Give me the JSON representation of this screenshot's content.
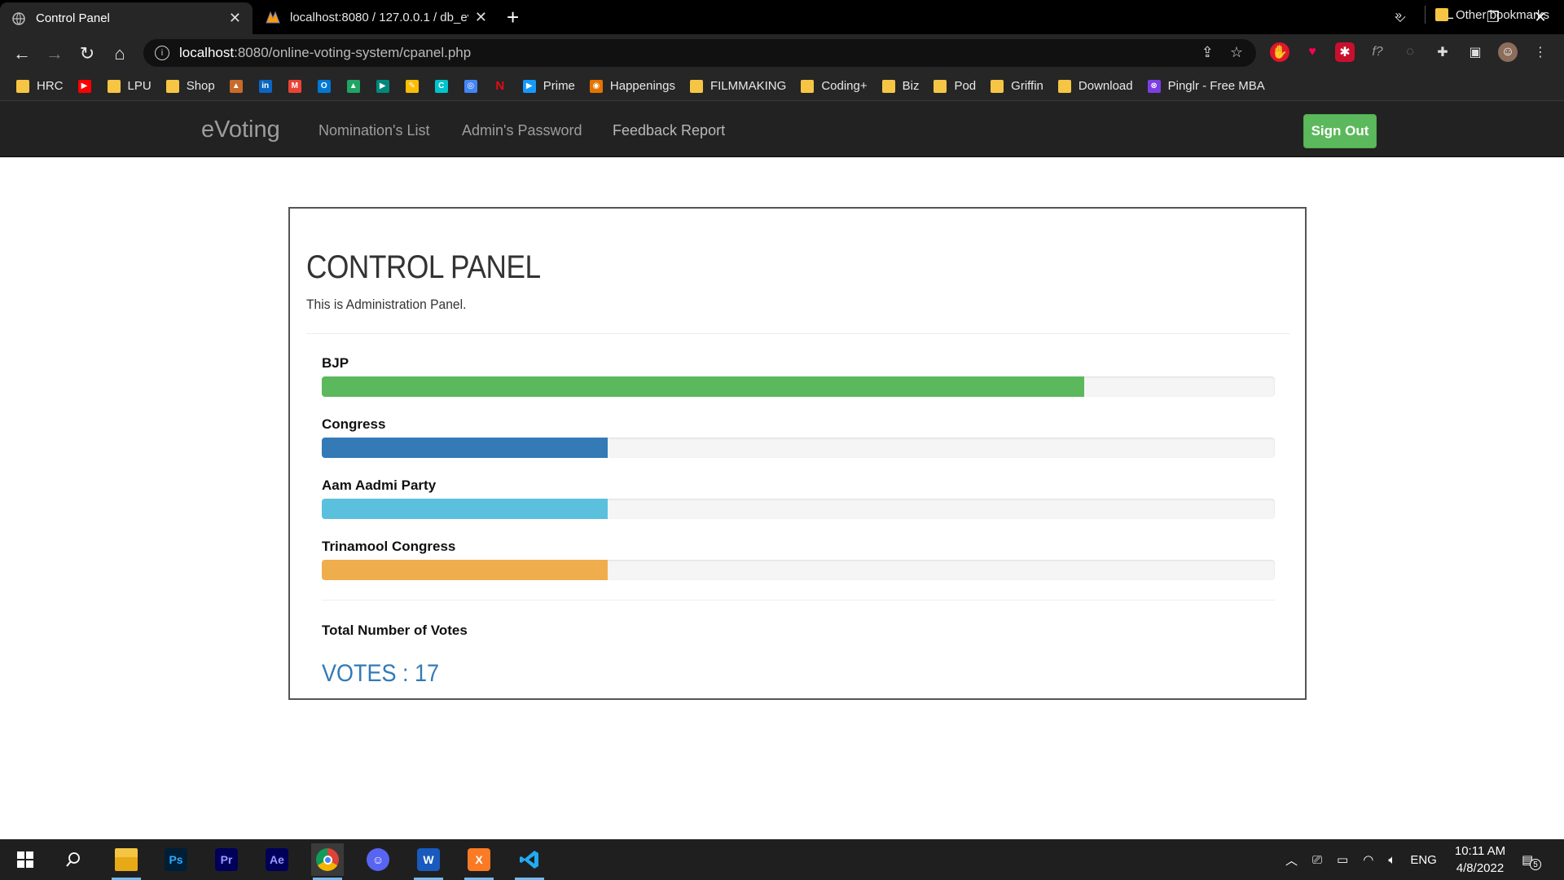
{
  "browser": {
    "tabs": [
      {
        "title": "Control Panel",
        "active": true
      },
      {
        "title": "localhost:8080 / 127.0.0.1 / db_ev",
        "active": false
      }
    ],
    "url_host": "localhost",
    "url_rest": ":8080/online-voting-system/cpanel.php",
    "bookmarks": [
      {
        "label": "HRC",
        "icon": "folder-icon"
      },
      {
        "label": "",
        "icon": "youtube-icon"
      },
      {
        "label": "LPU",
        "icon": "folder-icon"
      },
      {
        "label": "Shop",
        "icon": "folder-icon"
      },
      {
        "label": "",
        "icon": "triangle-icon"
      },
      {
        "label": "",
        "icon": "linkedin-icon"
      },
      {
        "label": "",
        "icon": "gmail-icon"
      },
      {
        "label": "",
        "icon": "outlook-icon"
      },
      {
        "label": "",
        "icon": "drive-icon"
      },
      {
        "label": "",
        "icon": "meet-icon"
      },
      {
        "label": "",
        "icon": "keep-icon"
      },
      {
        "label": "",
        "icon": "canva-icon"
      },
      {
        "label": "",
        "icon": "podcast-icon"
      },
      {
        "label": "",
        "icon": "netflix-icon"
      },
      {
        "label": "Prime",
        "icon": "prime-icon"
      },
      {
        "label": "Happenings",
        "icon": "happenings-icon"
      },
      {
        "label": "FILMMAKING",
        "icon": "folder-icon"
      },
      {
        "label": "Coding+",
        "icon": "folder-icon"
      },
      {
        "label": "Biz",
        "icon": "folder-icon"
      },
      {
        "label": "Pod",
        "icon": "folder-icon"
      },
      {
        "label": "Griffin",
        "icon": "folder-icon"
      },
      {
        "label": "Download",
        "icon": "folder-icon"
      },
      {
        "label": "Pinglr - Free MBA",
        "icon": "pinglr-icon"
      }
    ],
    "bookmarks_overflow": "»",
    "other_bookmarks": "Other bookmarks"
  },
  "site": {
    "brand": "eVoting",
    "nav": [
      "Nomination's List",
      "Admin's Password",
      "Feedback Report"
    ],
    "signout_label": "Sign Out"
  },
  "panel": {
    "title": "CONTROL PANEL",
    "subtitle": "This is Administration Panel.",
    "parties": [
      {
        "name": "BJP",
        "fraction": 0.8,
        "color": "#5cb85c"
      },
      {
        "name": "Congress",
        "fraction": 0.3,
        "color": "#337ab7"
      },
      {
        "name": "Aam Aadmi Party",
        "fraction": 0.3,
        "color": "#5bc0de"
      },
      {
        "name": "Trinamool Congress",
        "fraction": 0.3,
        "color": "#f0ad4e"
      }
    ],
    "total_label": "Total Number of Votes",
    "votes_text": "VOTES : 17"
  },
  "taskbar": {
    "apps": [
      {
        "name": "file-explorer-icon",
        "label": "",
        "color": "#f4c542"
      },
      {
        "name": "photoshop-icon",
        "label": "Ps",
        "color": "#001e36"
      },
      {
        "name": "premiere-icon",
        "label": "Pr",
        "color": "#00005b"
      },
      {
        "name": "after-effects-icon",
        "label": "Ae",
        "color": "#00005b"
      },
      {
        "name": "chrome-icon",
        "label": "",
        "color": "#db4437"
      },
      {
        "name": "discord-icon",
        "label": "",
        "color": "#5865f2"
      },
      {
        "name": "word-icon",
        "label": "W",
        "color": "#185abd"
      },
      {
        "name": "xampp-icon",
        "label": "X",
        "color": "#fb7a24"
      },
      {
        "name": "vscode-icon",
        "label": "",
        "color": "#007acc"
      }
    ],
    "lang": "ENG",
    "time": "10:11 AM",
    "date": "4/8/2022",
    "notification_count": "5"
  }
}
